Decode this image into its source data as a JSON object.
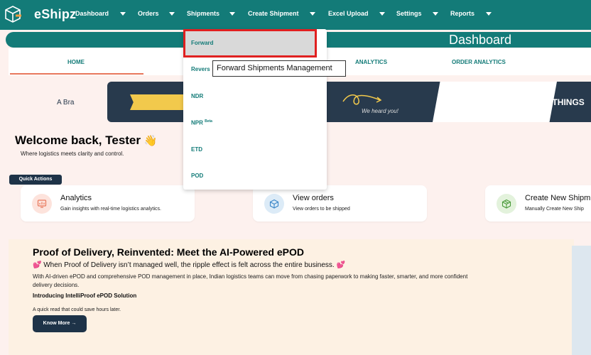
{
  "app": {
    "name": "eShipz"
  },
  "nav": [
    {
      "label": "Dashboard"
    },
    {
      "label": "Orders"
    },
    {
      "label": "Shipments"
    },
    {
      "label": "Create Shipment"
    },
    {
      "label": "Excel Upload"
    },
    {
      "label": "Settings"
    },
    {
      "label": "Reports"
    }
  ],
  "header": {
    "title": "Dashboard"
  },
  "tabs": [
    {
      "label": "HOME"
    },
    {
      "label": "ANALYTICS"
    },
    {
      "label": "ORDER ANALYTICS"
    }
  ],
  "banner": {
    "tag": "A Bra",
    "heard": "We heard you!",
    "headline": "GREAT THINGS"
  },
  "welcome": {
    "title": "Welcome back, Tester",
    "emoji": "👋",
    "subtitle": "Where logistics meets clarity and control."
  },
  "quick_actions": {
    "label": "Quick Actions",
    "cards": [
      {
        "title": "Analytics",
        "subtitle": "Gain insights with real-time logistics analytics.",
        "icon": "chart-icon",
        "icon_color": "#fde3dc"
      },
      {
        "title": "View orders",
        "subtitle": "View orders to be shipped",
        "icon": "box-icon",
        "icon_color": "#dcebf7"
      },
      {
        "title": "Create New Shipm",
        "subtitle": "Manually Create New Ship",
        "icon": "package-icon",
        "icon_color": "#e3f2dc"
      }
    ]
  },
  "promo": {
    "title": "Proof of Delivery, Reinvented: Meet the AI-Powered ePOD",
    "line": "When Proof of Delivery isn’t managed well, the ripple effect is felt across the entire business.",
    "body": "With AI-driven ePOD and comprehensive POD management in place, Indian logistics teams can move from chasing paperwork to making faster, smarter, and more confident delivery decisions.",
    "intro": "Introducing IntelliProof ePOD Solution",
    "quick": "A quick read that could save hours later.",
    "button": "Know More →"
  },
  "dropdown": {
    "items": [
      {
        "label": "Forward"
      },
      {
        "label": "Revers"
      },
      {
        "label": "NDR"
      },
      {
        "label": "NPR",
        "sup": "Beta"
      },
      {
        "label": "ETD"
      },
      {
        "label": "POD"
      }
    ]
  },
  "tooltip": {
    "text": "Forward Shipments Management"
  },
  "colors": {
    "brand": "#137b78",
    "accent": "#e8775b",
    "navy": "#1e3348",
    "highlight": "#e02020"
  }
}
